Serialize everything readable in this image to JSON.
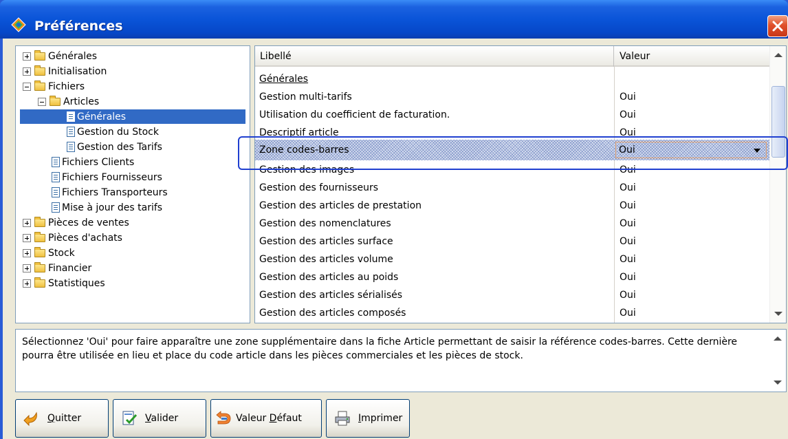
{
  "window": {
    "title": "Préférences"
  },
  "tree": {
    "items": [
      {
        "label": "Générales",
        "kind": "folder",
        "expander": "plus",
        "level": 0
      },
      {
        "label": "Initialisation",
        "kind": "folder",
        "expander": "plus",
        "level": 0
      },
      {
        "label": "Fichiers",
        "kind": "folder",
        "expander": "minus",
        "level": 0
      },
      {
        "label": "Articles",
        "kind": "folder",
        "expander": "minus",
        "level": 1
      },
      {
        "label": "Générales",
        "kind": "doc",
        "level": 2,
        "selected": true
      },
      {
        "label": "Gestion du Stock",
        "kind": "doc",
        "level": 2
      },
      {
        "label": "Gestion des Tarifs",
        "kind": "doc",
        "level": 2
      },
      {
        "label": "Fichiers Clients",
        "kind": "doc",
        "level": 1
      },
      {
        "label": "Fichiers Fournisseurs",
        "kind": "doc",
        "level": 1
      },
      {
        "label": "Fichiers Transporteurs",
        "kind": "doc",
        "level": 1
      },
      {
        "label": "Mise à jour des tarifs",
        "kind": "doc",
        "level": 1
      },
      {
        "label": "Pièces de ventes",
        "kind": "folder",
        "expander": "plus",
        "level": 0
      },
      {
        "label": "Pièces d'achats",
        "kind": "folder",
        "expander": "plus",
        "level": 0
      },
      {
        "label": "Stock",
        "kind": "folder",
        "expander": "plus",
        "level": 0
      },
      {
        "label": "Financier",
        "kind": "folder",
        "expander": "plus",
        "level": 0
      },
      {
        "label": "Statistiques",
        "kind": "folder",
        "expander": "plus",
        "level": 0
      }
    ]
  },
  "grid": {
    "headers": {
      "libelle": "Libellé",
      "valeur": "Valeur"
    },
    "rows": [
      {
        "libelle": "Générales",
        "valeur": "",
        "section": true
      },
      {
        "libelle": "Gestion multi-tarifs",
        "valeur": "Oui"
      },
      {
        "libelle": "Utilisation du coefficient de facturation.",
        "valeur": "Oui"
      },
      {
        "libelle": "Descriptif article",
        "valeur": "Oui"
      },
      {
        "libelle": "Zone codes-barres",
        "valeur": "Oui",
        "editing": true
      },
      {
        "libelle": "Gestion des images",
        "valeur": "Oui"
      },
      {
        "libelle": "Gestion des fournisseurs",
        "valeur": "Oui"
      },
      {
        "libelle": "Gestion des articles de prestation",
        "valeur": "Oui"
      },
      {
        "libelle": "Gestion des nomenclatures",
        "valeur": "Oui"
      },
      {
        "libelle": "Gestion des articles surface",
        "valeur": "Oui"
      },
      {
        "libelle": "Gestion des articles volume",
        "valeur": "Oui"
      },
      {
        "libelle": "Gestion des articles au poids",
        "valeur": "Oui"
      },
      {
        "libelle": "Gestion des articles sérialisés",
        "valeur": "Oui"
      },
      {
        "libelle": "Gestion des articles composés",
        "valeur": "Oui"
      }
    ]
  },
  "description": {
    "text": "Sélectionnez 'Oui' pour faire apparaître une zone supplémentaire dans la fiche Article permettant de saisir la référence codes-barres. Cette dernière pourra être utilisée en lieu et place du code article dans les pièces commerciales et les pièces de stock."
  },
  "buttons": {
    "quitter": {
      "mnemonic": "Q",
      "rest": "uitter",
      "icon": "exit-arrow-icon"
    },
    "valider": {
      "mnemonic": "V",
      "rest": "alider",
      "icon": "validate-doc-icon"
    },
    "valeur_defaut": {
      "pre": "Valeur ",
      "mnemonic": "D",
      "rest": "éfaut",
      "icon": "reset-arrow-icon"
    },
    "imprimer": {
      "mnemonic": "I",
      "rest": "mprimer",
      "icon": "printer-icon"
    }
  },
  "colors": {
    "titlebar": "#0a54d8",
    "window": "#ece9d8",
    "selection": "#316ac5",
    "focus_outline": "#1f3fd0"
  }
}
